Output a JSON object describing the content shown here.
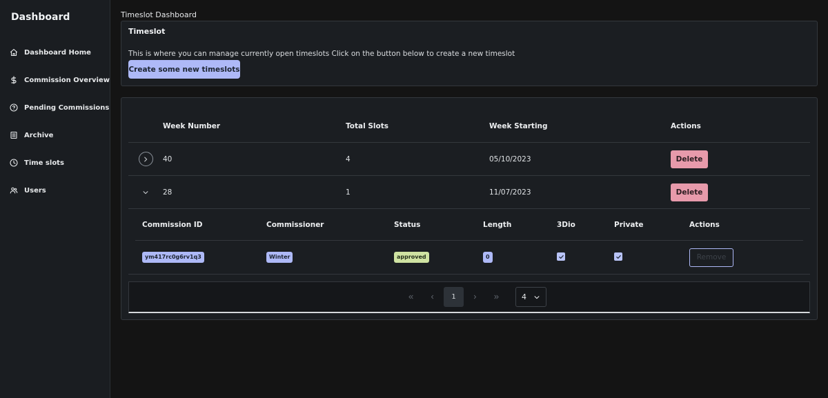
{
  "sidebar": {
    "brand": "Dashboard",
    "items": [
      {
        "label": "Dashboard Home",
        "icon": "home-icon"
      },
      {
        "label": "Commission Overview",
        "icon": "dollar-icon"
      },
      {
        "label": "Pending Commissions",
        "icon": "question-circle-icon"
      },
      {
        "label": "Archive",
        "icon": "document-icon"
      },
      {
        "label": "Time slots",
        "icon": "clock-icon"
      },
      {
        "label": "Users",
        "icon": "users-icon"
      }
    ]
  },
  "page": {
    "title": "Timeslot Dashboard"
  },
  "timeslot_card": {
    "title": "Timeslot",
    "text": "This is where you can manage currently open timeslots Click on the button below to create a new timeslot",
    "create_label": "Create some new timeslots"
  },
  "weeks_table": {
    "headers": {
      "week": "Week Number",
      "total": "Total Slots",
      "start": "Week Starting",
      "actions": "Actions"
    },
    "rows": [
      {
        "week": "40",
        "total": "4",
        "start": "05/10/2023",
        "action": "Delete",
        "expanded": false
      },
      {
        "week": "28",
        "total": "1",
        "start": "11/07/2023",
        "action": "Delete",
        "expanded": true
      }
    ]
  },
  "commissions_table": {
    "headers": {
      "id": "Commission ID",
      "commissioner": "Commissioner",
      "status": "Status",
      "length": "Length",
      "threed": "3Dio",
      "private": "Private",
      "actions": "Actions"
    },
    "rows": [
      {
        "id": "ym417rc0g6rv1q3",
        "commissioner": "Winter",
        "status": "approved",
        "length": "0",
        "threed": true,
        "private": true,
        "action": "Remove"
      }
    ]
  },
  "pagination": {
    "current_page": "1",
    "page_size": "4"
  },
  "colors": {
    "accent": "#aeb9f7",
    "danger": "#e79aab",
    "success": "#cfe3a2",
    "sidebar_bg": "#1a1d21",
    "page_bg": "#141414"
  }
}
